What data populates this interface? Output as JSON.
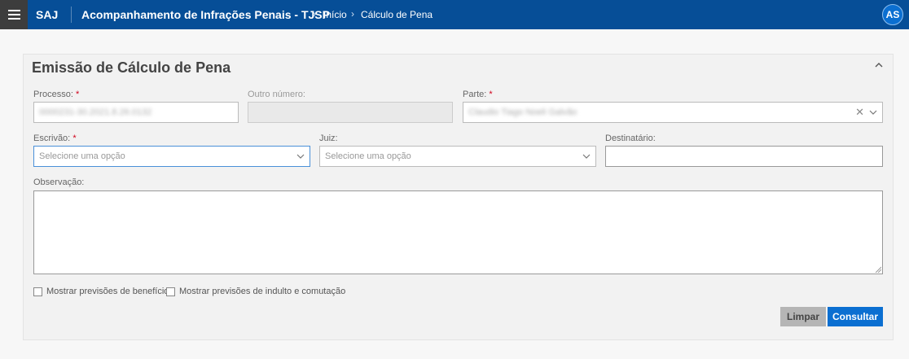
{
  "topbar": {
    "menu_icon": "hamburger-icon",
    "brand": "SAJ",
    "app_title": "Acompanhamento de Infrações Penais - TJSP",
    "breadcrumb": [
      "Início",
      "Cálculo de Pena"
    ],
    "breadcrumb_separator_icon": "chevron-right-icon",
    "user_initials": "AS",
    "colors": {
      "bar": "#064e97",
      "menu_button": "#3d3d3d",
      "avatar": "#0b6fd1"
    }
  },
  "panel": {
    "title": "Emissão de Cálculo de Pena",
    "collapse_icon": "chevron-up-icon",
    "fields": {
      "processo": {
        "label": "Processo:",
        "required": true,
        "value": "0000231-30.2021.8.26.0132"
      },
      "outro_numero": {
        "label": "Outro número:",
        "disabled": true,
        "value": ""
      },
      "parte": {
        "label": "Parte:",
        "required": true,
        "value": "Claudio Tiago Noeli Galvão"
      },
      "escrivao": {
        "label": "Escrivão:",
        "required": true,
        "placeholder": "Selecione uma opção"
      },
      "juiz": {
        "label": "Juiz:",
        "placeholder": "Selecione uma opção"
      },
      "destinatario": {
        "label": "Destinatário:",
        "value": ""
      },
      "observacao": {
        "label": "Observação:",
        "value": ""
      }
    },
    "checkboxes": [
      {
        "label": "Mostrar previsões de benefícios",
        "checked": false
      },
      {
        "label": "Mostrar previsões de indulto e comutação",
        "checked": false
      }
    ],
    "buttons": {
      "clear": "Limpar",
      "submit": "Consultar"
    },
    "colors": {
      "required": "#d0021b",
      "primary_button": "#0b6fd1",
      "secondary_button": "#b5b5b5"
    }
  }
}
